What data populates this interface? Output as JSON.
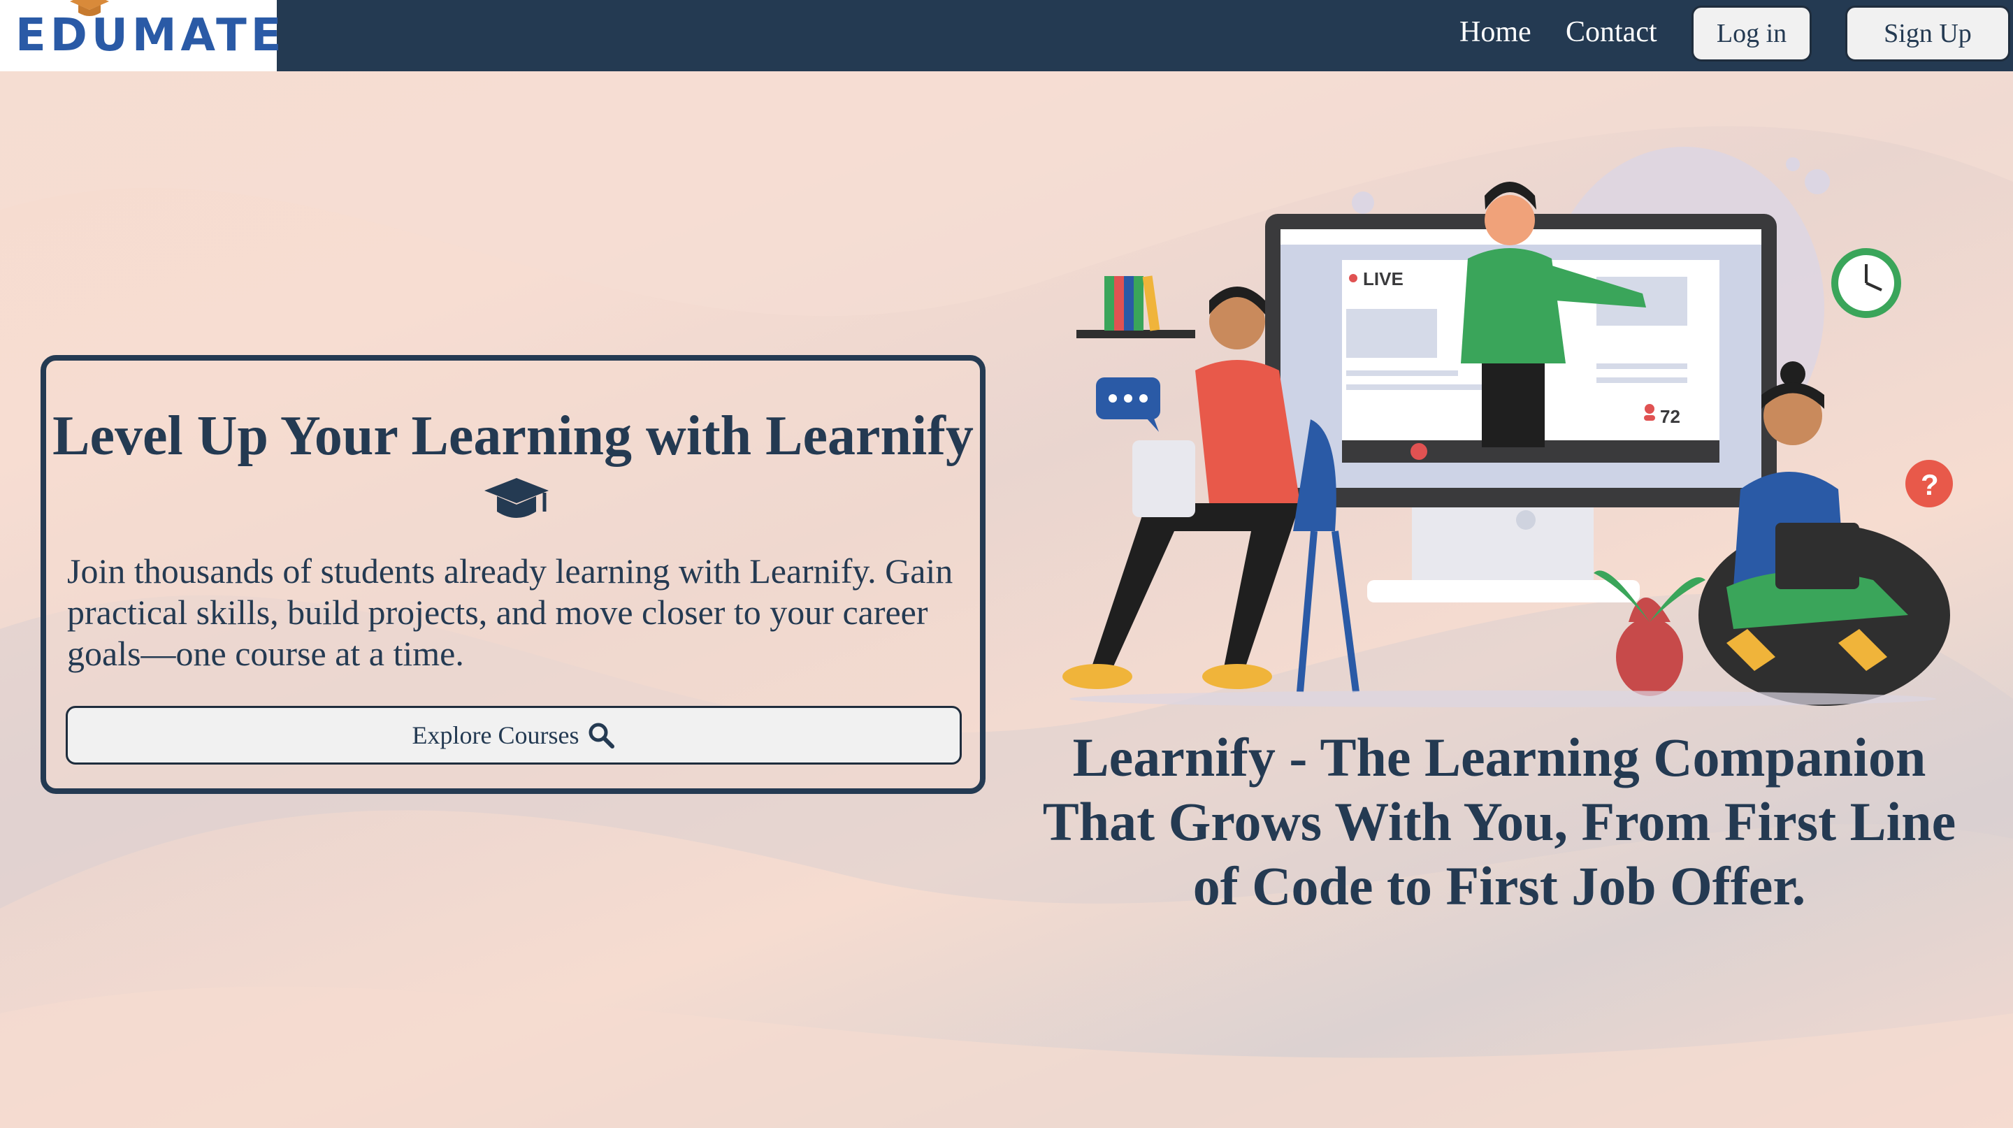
{
  "header": {
    "logo_text": "EDUMATE",
    "nav": {
      "home": "Home",
      "contact": "Contact"
    },
    "login_label": "Log in",
    "signup_label": "Sign Up"
  },
  "hero": {
    "title": "Level Up Your Learning with Learnify",
    "title_icon": "graduation-cap-icon",
    "description": "Join thousands of students already learning with Learnify. Gain practical skills, build projects, and move closer to your career goals—one course at a time.",
    "explore_label": "Explore Courses",
    "explore_icon": "search-icon"
  },
  "illustration": {
    "live_label": "LIVE",
    "viewer_count": "72"
  },
  "tagline": "Learnify - The Learning Companion That Grows With You, From First Line of Code to First Job Offer.",
  "colors": {
    "navy": "#243a52",
    "brand_blue": "#2a5aa6",
    "accent_orange": "#d98a3a",
    "green": "#3aa55a",
    "background": "#f6dccf"
  }
}
